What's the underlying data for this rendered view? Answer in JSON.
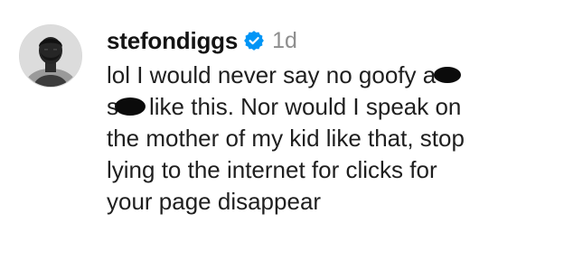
{
  "comment": {
    "username": "stefondiggs",
    "verified_icon": "verified-badge-icon",
    "verified_color": "#0095f6",
    "timestamp": "1d",
    "avatar_icon": "profile-photo",
    "lines": [
      {
        "before": "lol I would never say no goofy a",
        "after": ""
      },
      {
        "before": "s",
        "after": "like this. Nor would I speak on"
      },
      {
        "text": "the mother of my kid like that, stop"
      },
      {
        "text": "lying to the internet for clicks for"
      },
      {
        "text": "your page disappear"
      }
    ]
  }
}
